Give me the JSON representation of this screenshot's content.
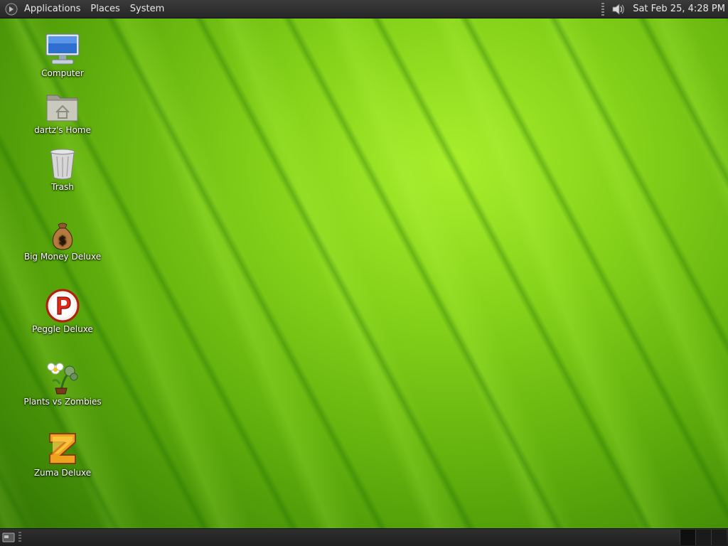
{
  "top_panel": {
    "menus": [
      "Applications",
      "Places",
      "System"
    ],
    "clock": "Sat Feb 25,  4:28 PM",
    "icons": {
      "logo": "gnome-foot-icon",
      "volume": "speaker-icon"
    }
  },
  "desktop_icons": [
    {
      "label": "Computer",
      "icon": "computer-icon"
    },
    {
      "label": "dartz's Home",
      "icon": "home-folder-icon"
    },
    {
      "label": "Trash",
      "icon": "trash-icon"
    },
    {
      "label": "Big Money Deluxe",
      "icon": "money-bag-icon"
    },
    {
      "label": "Peggle Deluxe",
      "icon": "peggle-icon"
    },
    {
      "label": "Plants vs Zombies",
      "icon": "plants-vs-zombies-icon"
    },
    {
      "label": "Zuma Deluxe",
      "icon": "zuma-icon"
    }
  ],
  "bottom_panel": {
    "icons": {
      "show_desktop": "show-desktop-icon"
    },
    "workspaces": 3
  },
  "colors": {
    "panel": "#2b2b2b",
    "wallpaper": "#7fcc18",
    "text": "#ffffff"
  }
}
